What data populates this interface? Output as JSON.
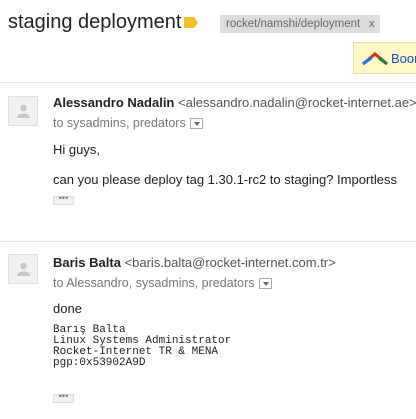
{
  "thread": {
    "subject": "staging deployment",
    "label_chip": "rocket/namshi/deployment",
    "label_remove": "x",
    "boomerang": "Boomerang"
  },
  "messages": [
    {
      "sender_name": "Alessandro Nadalin",
      "sender_email": "<alessandro.nadalin@rocket-internet.ae>",
      "recipients": "to sysadmins, predators",
      "greeting": "Hi guys,",
      "body": "can you please deploy tag 1.30.1-rc2 to staging? Importless",
      "ellipsis": "•••"
    },
    {
      "sender_name": "Baris Balta",
      "sender_email": "<baris.balta@rocket-internet.com.tr>",
      "recipients": "to Alessandro, sysadmins, predators",
      "body": "done",
      "signature": [
        "Barış Balta",
        "Linux Systems Administrator",
        "Rocket-Internet TR & MENA",
        "pgp:0x53902A9D"
      ],
      "ellipsis": "•••"
    }
  ],
  "colors": {
    "label_icon": "#f6c026",
    "chip_bg": "#dddddd",
    "boomerang_bg": "#fff8c4",
    "link": "#1155cc"
  }
}
